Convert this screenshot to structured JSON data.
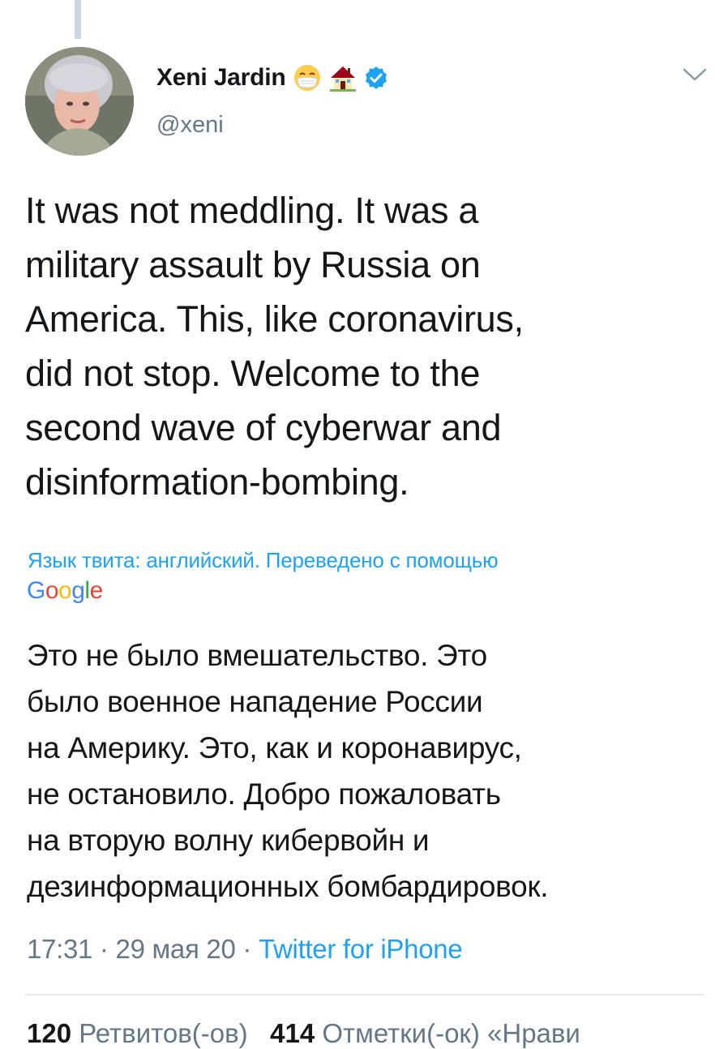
{
  "tweet": {
    "author": {
      "display_name": "Xeni Jardin",
      "emojis": [
        "face-mask-emoji",
        "house-emoji"
      ],
      "verified_icon": "verified-badge-icon",
      "handle": "@xeni",
      "avatar_icon": "avatar-photo"
    },
    "menu_icon": "chevron-down-icon",
    "text": "It was not meddling. It was a\nmilitary assault by Russia on\nAmerica. This, like coronavirus,\ndid not stop. Welcome to the\nsecond wave of cyberwar and\ndisinformation-bombing.",
    "translation_note": "Язык твита: английский. Переведено с помощью",
    "translation_provider": "Google",
    "translated_text": "Это не было вмешательство. Это\nбыло военное нападение России\nна Америку. Это, как и коронавирус,\nне остановило. Добро пожаловать\nна вторую волну кибервойн и\nдезинформационных бомбардировок.",
    "time": "17:31",
    "separator": "·",
    "date": "29 мая 20",
    "source": "Twitter for iPhone",
    "stats": {
      "retweets_count": "120",
      "retweets_label": "Ретвитов(-ов)",
      "likes_count": "414",
      "likes_label": "Отметки(-ок) «Нрави"
    }
  },
  "colors": {
    "text": "#14171a",
    "secondary": "#657786",
    "accent": "#1da1f2",
    "divider": "#e1e8ed",
    "verified": "#1da1f2"
  }
}
